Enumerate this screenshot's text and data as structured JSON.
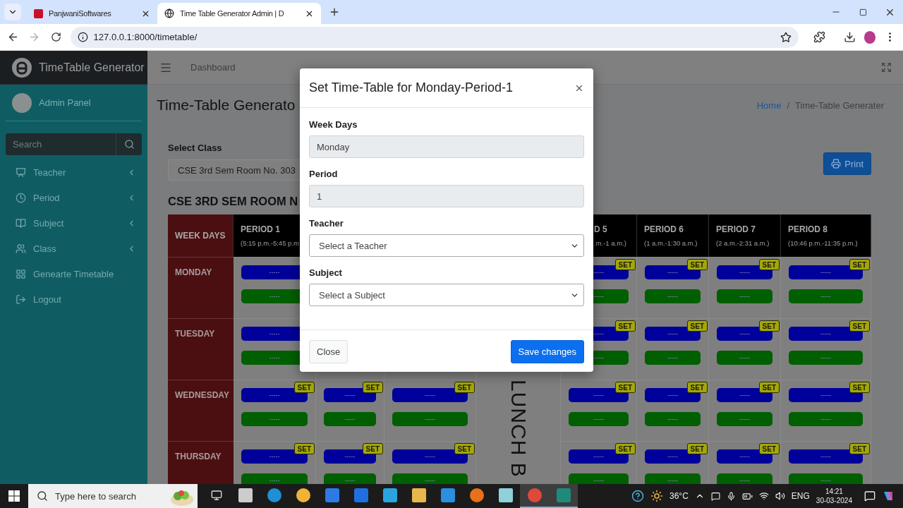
{
  "browser": {
    "tabs": [
      {
        "title": "PanjwaniSoftwares",
        "selected": false
      },
      {
        "title": "Time Table Generator Admin | D",
        "selected": true
      }
    ],
    "url": "127.0.0.1:8000/timetable/",
    "forward_disabled": true
  },
  "sidebar": {
    "brand": "TimeTable Generator",
    "user": "Admin Panel",
    "search": {
      "placeholder": "Search"
    },
    "items": [
      {
        "label": "Teacher",
        "expandable": true
      },
      {
        "label": "Period",
        "expandable": true
      },
      {
        "label": "Subject",
        "expandable": true
      },
      {
        "label": "Class",
        "expandable": true
      },
      {
        "label": "Genearte Timetable",
        "expandable": false
      },
      {
        "label": "Logout",
        "expandable": false
      }
    ]
  },
  "navbar": {
    "link": "Dashboard"
  },
  "page": {
    "title": "Time-Table Generato",
    "breadcrumb": [
      {
        "label": "Home",
        "kind": "link"
      },
      {
        "label": "/",
        "kind": "separator"
      },
      {
        "label": "Time-Table Generater",
        "kind": "current"
      }
    ]
  },
  "class_select": {
    "label": "Select Class",
    "value": "CSE 3rd Sem Room No. 303"
  },
  "print_button": "Print",
  "table_title": "CSE 3RD SEM ROOM N",
  "timetable": {
    "corner": "WEEK DAYS",
    "columns": [
      {
        "kind": "period",
        "title": "PERIOD 1",
        "time": "(5:15 p.m.-5:45 p.m"
      },
      {
        "kind": "period"
      },
      {
        "kind": "period"
      },
      {
        "kind": "lunch"
      },
      {
        "kind": "period",
        "title": "D 5",
        "time": ".m.-1 a.m.)",
        "cut_by_dialog": true
      },
      {
        "kind": "period",
        "title": "PERIOD 6",
        "time": "(1 a.m.-1:30 a.m.)"
      },
      {
        "kind": "period",
        "title": "PERIOD 7",
        "time": "(2 a.m.-2:31 a.m.)"
      },
      {
        "kind": "period",
        "title": "PERIOD 8",
        "time": "(10:46 p.m.-11:35 p.m.)"
      }
    ],
    "rows": [
      {
        "day": "MONDAY",
        "cells": [
          {
            "upper": "-----",
            "lower": "-----"
          },
          null,
          null,
          null,
          {
            "upper": "-----",
            "lower": "-----",
            "badge": "SET"
          },
          {
            "upper": "-----",
            "lower": "-----",
            "badge": "SET"
          },
          {
            "upper": "-----",
            "lower": "-----",
            "badge": "SET"
          },
          {
            "upper": "-----",
            "lower": "-----",
            "badge": "SET"
          }
        ]
      },
      {
        "day": "TUESDAY",
        "cells": [
          {
            "upper": "-----",
            "lower": "-----"
          },
          null,
          null,
          null,
          {
            "upper": "-----",
            "lower": "-----",
            "badge": "SET"
          },
          {
            "upper": "-----",
            "lower": "-----",
            "badge": "SET"
          },
          {
            "upper": "-----",
            "lower": "-----",
            "badge": "SET"
          },
          {
            "upper": "-----",
            "lower": "-----",
            "badge": "SET"
          }
        ]
      },
      {
        "day": "WEDNESDAY",
        "cells": [
          {
            "upper": "-----",
            "lower": "-----",
            "badge": "SET"
          },
          {
            "upper": "-----",
            "lower": "-----",
            "badge": "SET"
          },
          {
            "upper": "-----",
            "lower": "-----",
            "badge": "SET"
          },
          {
            "kind": "lunch",
            "label": "LUNCH B"
          },
          {
            "upper": "-----",
            "lower": "-----",
            "badge": "SET"
          },
          {
            "upper": "-----",
            "lower": "-----",
            "badge": "SET"
          },
          {
            "upper": "-----",
            "lower": "-----",
            "badge": "SET"
          },
          {
            "upper": "-----",
            "lower": "-----",
            "badge": "SET"
          }
        ]
      },
      {
        "day": "THURSDAY",
        "cells": [
          {
            "upper": "-----",
            "lower": "-----",
            "badge": "SET"
          },
          {
            "upper": "-----",
            "lower": "-----",
            "badge": "SET"
          },
          {
            "upper": "-----",
            "lower": "-----",
            "badge": "SET"
          },
          null,
          {
            "upper": "-----",
            "lower": "-----",
            "badge": "SET"
          },
          {
            "upper": "-----",
            "lower": "-----",
            "badge": "SET"
          },
          {
            "upper": "-----",
            "lower": "-----",
            "badge": "SET"
          },
          {
            "upper": "-----",
            "lower": "-----",
            "badge": "SET"
          }
        ]
      }
    ]
  },
  "modal": {
    "title": "Set Time-Table for Monday-Period-1",
    "fields": [
      {
        "kind": "input",
        "label": "Week Days",
        "value": "Monday",
        "disabled": true
      },
      {
        "kind": "input",
        "label": "Period",
        "value": "1",
        "disabled": true
      },
      {
        "kind": "select",
        "label": "Teacher",
        "value": "Select a Teacher",
        "disabled": false
      },
      {
        "kind": "select",
        "label": "Subject",
        "value": "Select a Subject",
        "disabled": false
      }
    ],
    "buttons": [
      {
        "label": "Close",
        "kind": "secondary"
      },
      {
        "label": "Save changes",
        "kind": "primary"
      }
    ]
  },
  "taskbar": {
    "search_placeholder": "Type here to search",
    "apps": [
      {
        "active": false
      },
      {
        "active": false
      },
      {
        "active": false
      },
      {
        "active": false
      },
      {
        "active": false
      },
      {
        "active": false
      },
      {
        "active": false
      },
      {
        "active": false
      },
      {
        "active": false
      },
      {
        "active": false
      },
      {
        "active": true
      },
      {
        "active": true
      }
    ],
    "temperature": "36°C",
    "language": "ENG",
    "time": "14:21",
    "date": "30-03-2024"
  }
}
